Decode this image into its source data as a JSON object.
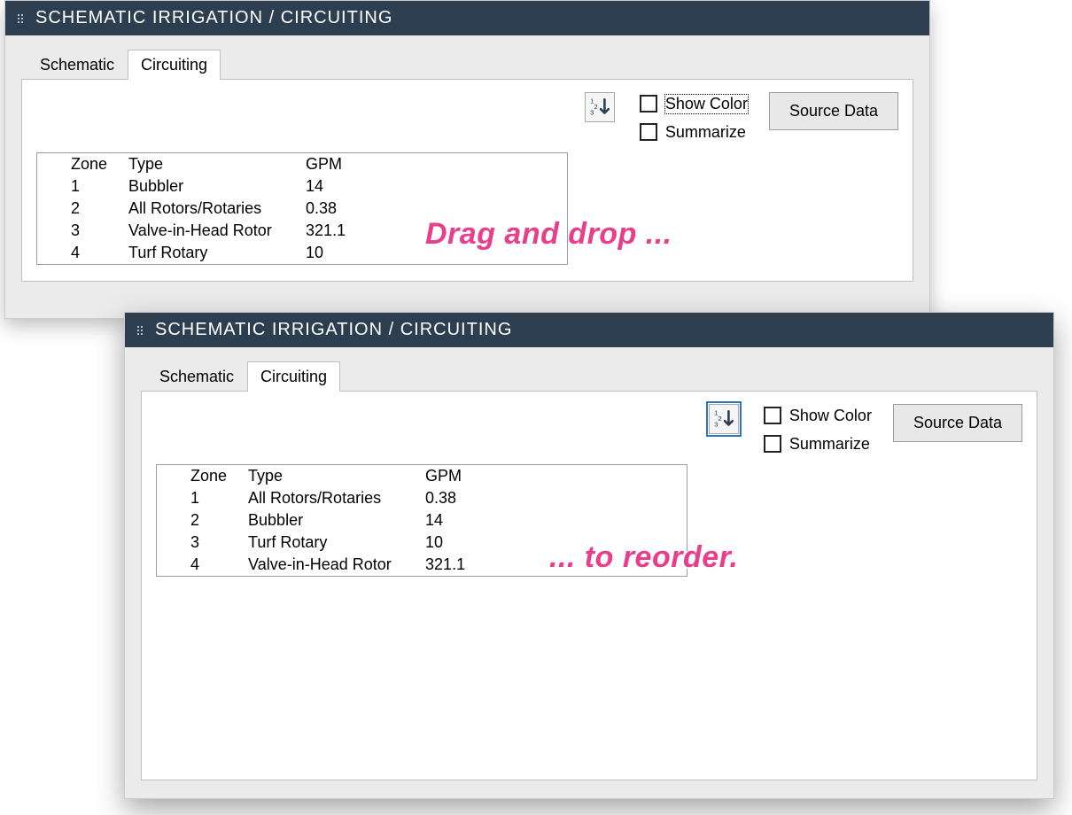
{
  "title": "SCHEMATIC IRRIGATION / CIRCUITING",
  "tabs": {
    "schematic": "Schematic",
    "circuiting": "Circuiting"
  },
  "options": {
    "show_color": "Show Color",
    "summarize": "Summarize"
  },
  "buttons": {
    "source_data": "Source Data"
  },
  "columns": {
    "zone": "Zone",
    "type": "Type",
    "gpm": "GPM"
  },
  "panel_a": {
    "rows": [
      {
        "zone": "1",
        "type": "Bubbler",
        "gpm": "14"
      },
      {
        "zone": "2",
        "type": "All Rotors/Rotaries",
        "gpm": "0.38"
      },
      {
        "zone": "3",
        "type": "Valve-in-Head Rotor",
        "gpm": "321.1"
      },
      {
        "zone": "4",
        "type": "Turf Rotary",
        "gpm": "10"
      }
    ]
  },
  "panel_b": {
    "rows": [
      {
        "zone": "1",
        "type": "All Rotors/Rotaries",
        "gpm": "0.38"
      },
      {
        "zone": "2",
        "type": "Bubbler",
        "gpm": "14"
      },
      {
        "zone": "3",
        "type": "Turf Rotary",
        "gpm": "10"
      },
      {
        "zone": "4",
        "type": "Valve-in-Head Rotor",
        "gpm": "321.1"
      }
    ]
  },
  "annotations": {
    "top": "Drag and drop ...",
    "bottom": "... to reorder."
  }
}
